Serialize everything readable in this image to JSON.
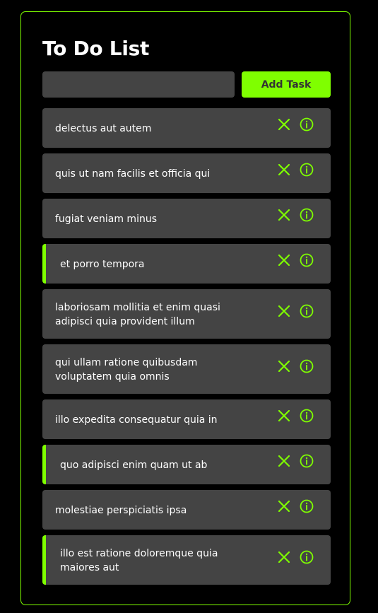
{
  "app": {
    "title": "To Do List"
  },
  "input": {
    "value": "",
    "placeholder": ""
  },
  "add_button": {
    "label": "Add Task"
  },
  "colors": {
    "accent": "#7fff00",
    "item_background": "#444444",
    "page_background": "#000000"
  },
  "tasks": [
    {
      "text": "delectus aut autem",
      "completed": false
    },
    {
      "text": "quis ut nam facilis et officia qui",
      "completed": false
    },
    {
      "text": "fugiat veniam minus",
      "completed": false
    },
    {
      "text": "et porro tempora",
      "completed": true
    },
    {
      "text": "laboriosam mollitia et enim quasi adipisci quia provident illum",
      "completed": false
    },
    {
      "text": "qui ullam ratione quibusdam voluptatem quia omnis",
      "completed": false
    },
    {
      "text": "illo expedita consequatur quia in",
      "completed": false
    },
    {
      "text": "quo adipisci enim quam ut ab",
      "completed": true
    },
    {
      "text": "molestiae perspiciatis ipsa",
      "completed": false
    },
    {
      "text": "illo est ratione doloremque quia maiores aut",
      "completed": true
    }
  ],
  "icons": {
    "delete": "close-icon",
    "info": "info-icon"
  }
}
